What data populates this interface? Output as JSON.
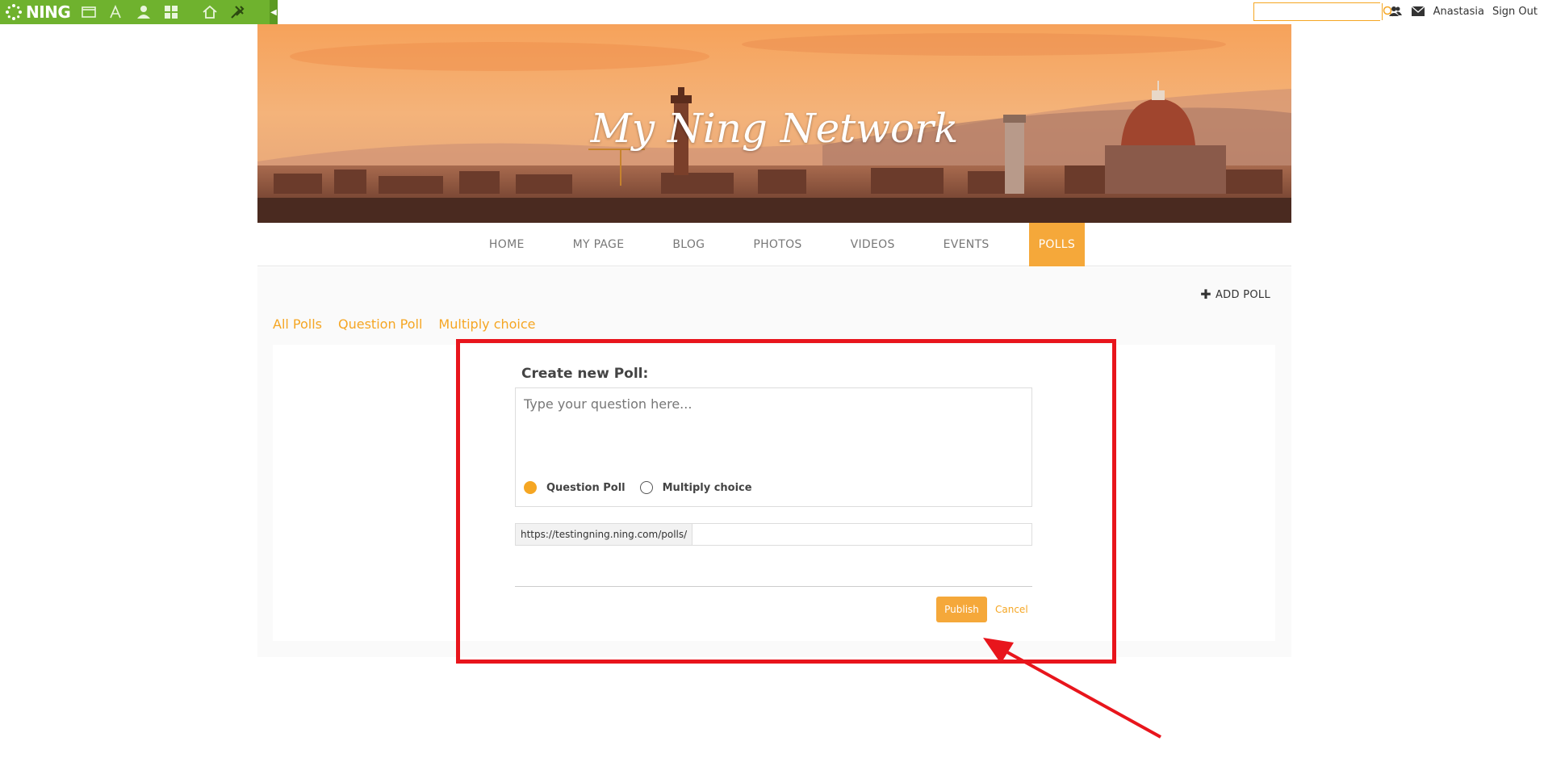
{
  "admin_bar": {
    "logo_text": "NING",
    "icons": [
      "ning-logo-icon",
      "window-icon",
      "font-icon",
      "user-icon",
      "grid-icon",
      "home-icon",
      "tools-icon",
      "collapse-arrow-icon"
    ],
    "accent": "#6fb22e"
  },
  "user_bar": {
    "search_placeholder": "",
    "user_name": "Anastasia",
    "sign_out": "Sign Out"
  },
  "banner": {
    "site_title": "My Ning Network"
  },
  "nav": {
    "items": [
      {
        "label": "HOME"
      },
      {
        "label": "MY PAGE"
      },
      {
        "label": "BLOG"
      },
      {
        "label": "PHOTOS"
      },
      {
        "label": "VIDEOS"
      },
      {
        "label": "EVENTS"
      },
      {
        "label": "POLLS",
        "active": true
      }
    ],
    "active_color": "#f5a83a"
  },
  "polls": {
    "add_poll": "ADD POLL",
    "subtabs": [
      "All Polls",
      "Question Poll",
      "Multiply choice"
    ],
    "form": {
      "title": "Create new Poll:",
      "question_placeholder": "Type your question here...",
      "options": [
        {
          "label": "Question Poll",
          "checked": true
        },
        {
          "label": "Multiply choice",
          "checked": false
        }
      ],
      "url_prefix": "https://testingning.ning.com/polls/",
      "url_value": "",
      "publish": "Publish",
      "cancel": "Cancel"
    }
  },
  "annotation": {
    "color": "#e8151c"
  }
}
